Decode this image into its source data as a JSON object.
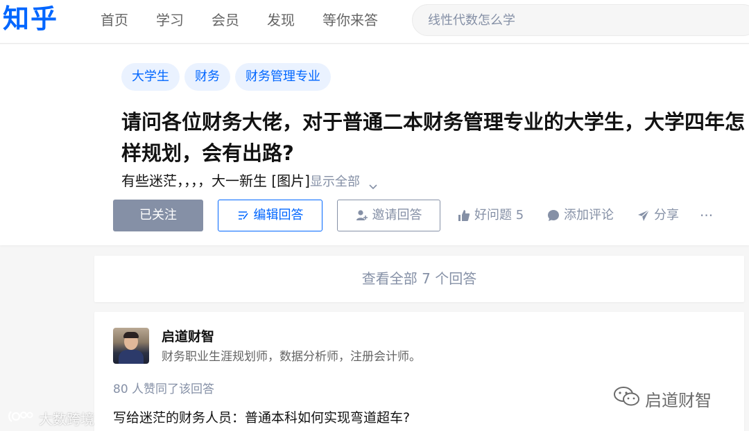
{
  "header": {
    "logo": "知乎",
    "nav": [
      "首页",
      "学习",
      "会员",
      "发现",
      "等你来答"
    ],
    "search_placeholder": "线性代数怎么学"
  },
  "question": {
    "tags": [
      "大学生",
      "财务",
      "财务管理专业"
    ],
    "title": "请问各位财务大佬，对于普通二本财务管理专业的大学生，大学四年怎样规划，会有出路?",
    "detail": "有些迷茫，，，，大一新生 [图片]",
    "show_all": "显示全部",
    "actions": {
      "follow": "已关注",
      "edit": "编辑回答",
      "invite": "邀请回答",
      "good_question": "好问题 5",
      "comment": "添加评论",
      "share": "分享",
      "more": "···"
    }
  },
  "view_all": "查看全部 7 个回答",
  "answer": {
    "author": "启道财智",
    "bio": "财务职业生涯规划师，数据分析师，注册会计师。",
    "votes": "80 人赞同了该回答",
    "excerpt": "写给迷茫的财务人员：普通本科如何实现弯道超车?"
  },
  "watermarks": {
    "left": "大数跨境",
    "right": "启道财智"
  },
  "colors": {
    "brand": "#0066ff",
    "muted": "#8590a6",
    "tag_bg": "#eaf2ff"
  }
}
